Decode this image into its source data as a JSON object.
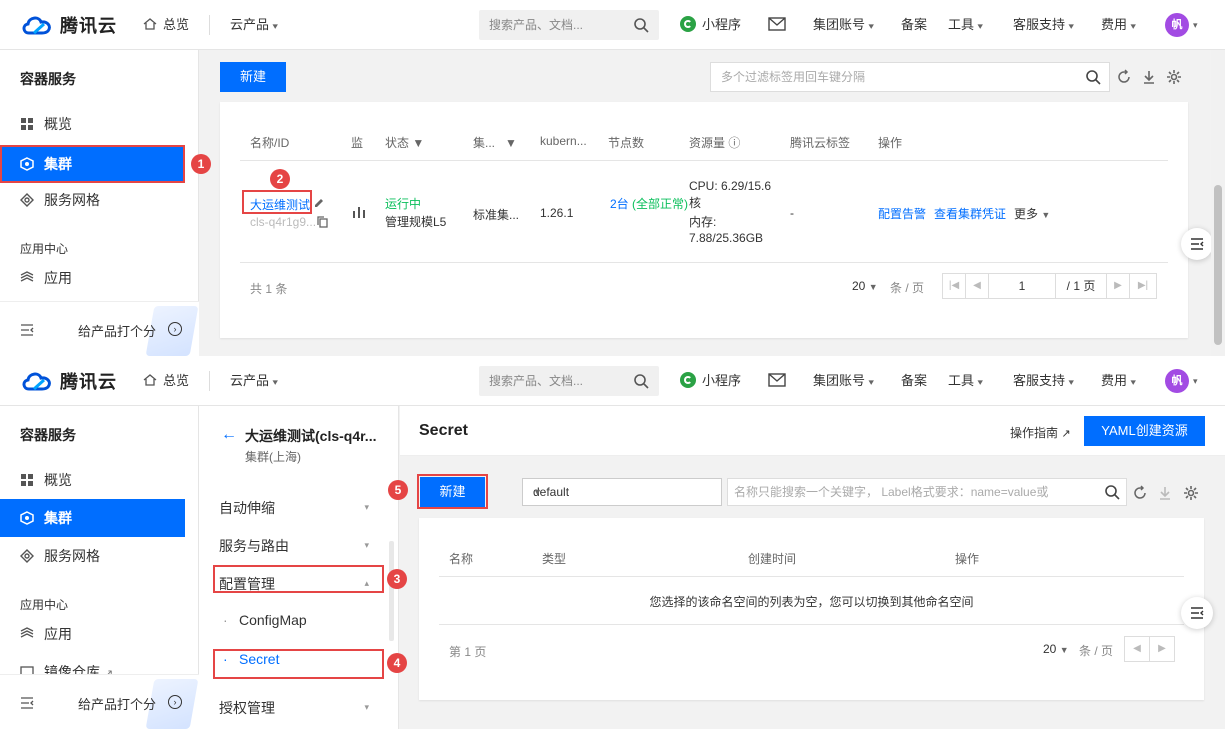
{
  "nav": {
    "brand": "腾讯云",
    "home": "总览",
    "products": "云产品",
    "search_placeholder": "搜索产品、文档...",
    "mini_program": "小程序",
    "group_account": "集团账号",
    "record": "备案",
    "tools": "工具",
    "support": "客服支持",
    "fee": "费用",
    "avatar": "帆"
  },
  "sidebar": {
    "title": "容器服务",
    "overview": "概览",
    "cluster": "集群",
    "mesh": "服务网格",
    "app_center": "应用中心",
    "app": "应用",
    "image_repo": "镜像仓库",
    "rate": "给产品打个分"
  },
  "cluster_list": {
    "new_button": "新建",
    "filter_placeholder": "多个过滤标签用回车键分隔",
    "columns": [
      "名称/ID",
      "监",
      "状态",
      "集...",
      "kubern...",
      "节点数",
      "资源量",
      "腾讯云标签",
      "操作"
    ],
    "row": {
      "name": "大运维测试",
      "id": "cls-q4r1g9...",
      "status": "运行中",
      "scale": "管理规模L5",
      "type": "标准集...",
      "k8s": "1.26.1",
      "nodes": "2台",
      "nodes_state": "(全部正常)",
      "cpu": "CPU: 6.29/15.6核",
      "mem_label": "内存:",
      "mem": "7.88/25.36GB",
      "tag": "-",
      "op_alarm": "配置告警",
      "op_cred": "查看集群凭证",
      "op_more": "更多"
    },
    "total": "共 1 条",
    "page_size": "20",
    "per_page": "条 / 页",
    "page_num": "1",
    "page_total": "/ 1 页"
  },
  "detail": {
    "cluster_name": "大运维测试(cls-q4r...",
    "cluster_region": "集群(上海)",
    "menu": {
      "autoscale": "自动伸缩",
      "service_route": "服务与路由",
      "config_mgmt": "配置管理",
      "configmap": "ConfigMap",
      "secret": "Secret",
      "auth_mgmt": "授权管理"
    },
    "page_title": "Secret",
    "guide": "操作指南",
    "yaml_button": "YAML创建资源",
    "new_button": "新建",
    "namespace": "default",
    "filter_placeholder": "名称只能搜索一个关键字， Label格式要求：name=value或",
    "columns": [
      "名称",
      "类型",
      "创建时间",
      "操作"
    ],
    "empty_text": "您选择的该命名空间的列表为空，您可以切换到其他命名空间",
    "page_label": "第 1 页",
    "page_size": "20",
    "per_page": "条 / 页"
  },
  "badges": [
    "1",
    "2",
    "3",
    "4",
    "5"
  ],
  "colors": {
    "primary": "#006eff",
    "annotation_red": "#e54545",
    "running_green": "#0abf5b",
    "avatar": "#a24be3"
  }
}
